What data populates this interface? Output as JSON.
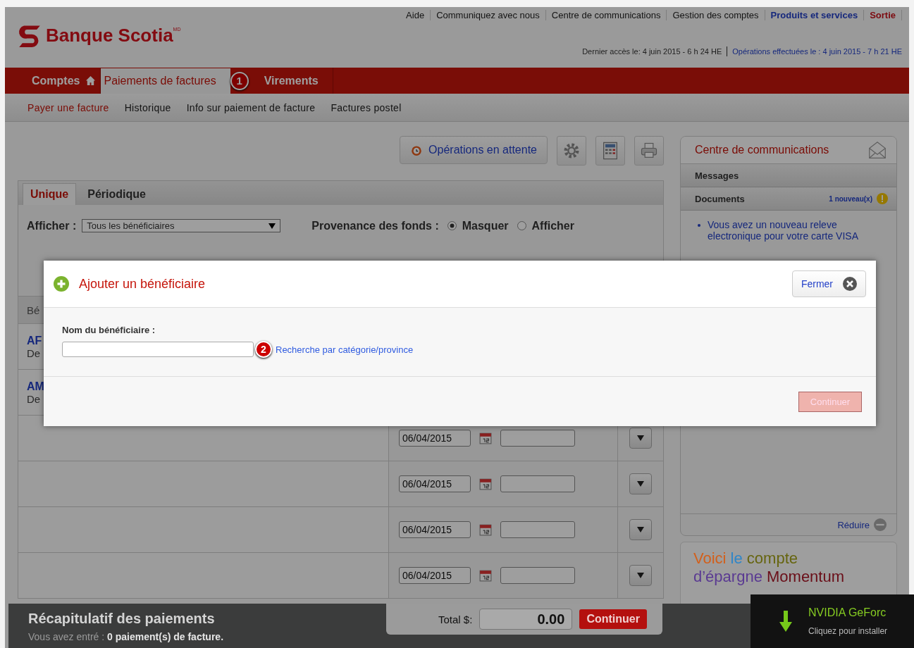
{
  "top_links": [
    {
      "label": "Aide",
      "kind": "plain"
    },
    {
      "label": "Communiquez avec nous",
      "kind": "plain"
    },
    {
      "label": "Centre de communications",
      "kind": "plain"
    },
    {
      "label": "Gestion des comptes",
      "kind": "plain"
    },
    {
      "label": "Produits et services",
      "kind": "link"
    },
    {
      "label": "Sortie",
      "kind": "exit"
    }
  ],
  "logo": {
    "name": "Banque Scotia",
    "mark": "MD"
  },
  "last_access": "Dernier accès le: 4 juin 2015 - 6 h 24 HE",
  "operations_link": "Opérations effectuées le : 4 juin 2015 - 7 h 21 HE",
  "nav_tabs": [
    {
      "label": "Comptes",
      "selected": false,
      "home": true
    },
    {
      "label": "Paiements de factures",
      "selected": true,
      "callout": "1"
    },
    {
      "label": "Virements",
      "selected": false
    }
  ],
  "subnav": [
    {
      "label": "Payer une facture",
      "selected": true
    },
    {
      "label": "Historique",
      "selected": false
    },
    {
      "label": "Info sur paiement de facture",
      "selected": false
    },
    {
      "label": "Factures postel",
      "selected": false
    }
  ],
  "pending_button": "Opérations en attente",
  "payment_tabs": [
    {
      "label": "Unique",
      "selected": true
    },
    {
      "label": "Périodique",
      "selected": false
    }
  ],
  "filter": {
    "label": "Afficher :",
    "select_value": "Tous les bénéficiaires",
    "funds_label": "Provenance des fonds :",
    "options": [
      {
        "label": "Masquer",
        "selected": true
      },
      {
        "label": "Afficher",
        "selected": false
      }
    ]
  },
  "table": {
    "header": "Bé",
    "rows": [
      {
        "kind": "payee",
        "name": "AF",
        "detail": "De"
      },
      {
        "kind": "payee",
        "name": "AM",
        "detail": "De"
      },
      {
        "kind": "entry",
        "date": "06/04/2015"
      },
      {
        "kind": "entry",
        "date": "06/04/2015"
      },
      {
        "kind": "entry",
        "date": "06/04/2015"
      },
      {
        "kind": "entry",
        "date": "06/04/2015"
      }
    ]
  },
  "modal": {
    "title": "Ajouter un bénéficiaire",
    "close_button": "Fermer",
    "field_label": "Nom du bénéficiaire :",
    "callout": "2",
    "search_link": "Recherche par catégorie/province",
    "continue_button": "Continuer",
    "continue_disabled": true
  },
  "comm_center": {
    "title": "Centre de communications",
    "sections": [
      {
        "label": "Messages"
      },
      {
        "label": "Documents",
        "badge": "1 nouveau(x)"
      }
    ],
    "items": [
      "Vous avez un nouveau releve electronique pour votre carte VISA"
    ],
    "collapse_link": "Réduire"
  },
  "promo": {
    "words": [
      {
        "text": "Voici",
        "color": "#d2601c"
      },
      {
        "text": "le",
        "color": "#2f86c8"
      },
      {
        "text": "compte",
        "color": "#66650f"
      },
      {
        "text": "d’épargne",
        "color": "#5a3a92"
      },
      {
        "text": "Momentum",
        "color": "#6a0e18"
      }
    ]
  },
  "summary": {
    "title": "Récapitulatif des paiements",
    "text": "Vous avez entré : **0 paiement(s) de facture.**",
    "total_label": "Total $:",
    "total_value": "0.00",
    "continue_button": "Continuer"
  },
  "notification": {
    "title": "NVIDIA GeForc",
    "text": "Cliquez pour installer"
  }
}
